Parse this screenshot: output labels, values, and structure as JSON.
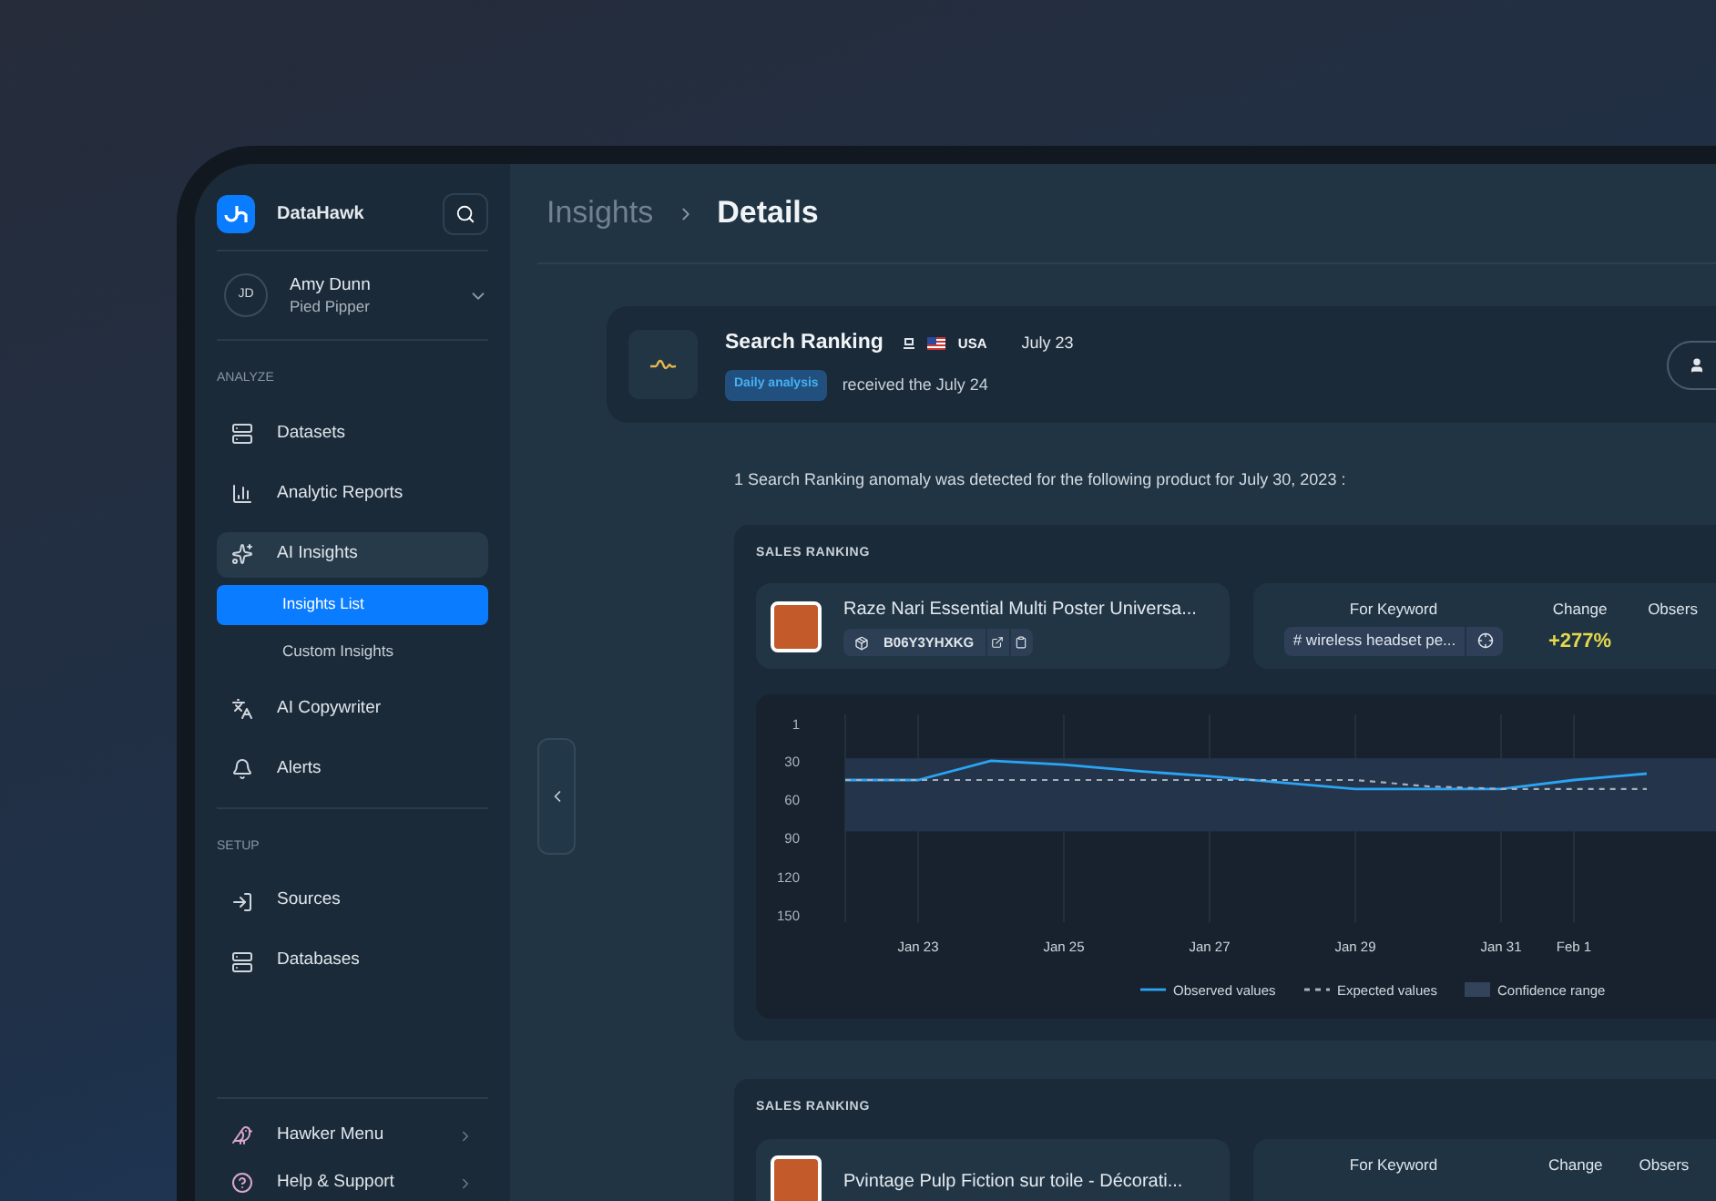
{
  "sidebar": {
    "brand": "DataHawk",
    "user": {
      "initials": "JD",
      "name": "Amy Dunn",
      "company": "Pied Pipper"
    },
    "sections": [
      {
        "title": "ANALYZE",
        "items": [
          {
            "label": "Datasets",
            "selected": false
          },
          {
            "label": "Analytic Reports",
            "selected": false
          },
          {
            "label": "AI Insights",
            "selected": true,
            "children": [
              {
                "label": "Insights List",
                "selected": true
              },
              {
                "label": "Custom Insights",
                "selected": false
              }
            ]
          },
          {
            "label": "AI Copywriter",
            "selected": false
          },
          {
            "label": "Alerts",
            "selected": false
          }
        ]
      },
      {
        "title": "SETUP",
        "items": [
          {
            "label": "Sources",
            "selected": false
          },
          {
            "label": "Databases",
            "selected": false
          }
        ]
      }
    ],
    "footer": [
      {
        "label": "Hawker Menu"
      },
      {
        "label": "Help & Support"
      }
    ]
  },
  "breadcrumb": [
    "Insights",
    "Details"
  ],
  "insight": {
    "title": "Search Ranking",
    "country": "USA",
    "date": "July 23",
    "badge": "Daily analysis",
    "received": "received the July 24"
  },
  "summary": "1 Search Ranking anomaly was detected for the following product for July 30, 2023 :",
  "sections": [
    {
      "title": "SALES RANKING",
      "product": "Raze Nari Essential Multi Poster Universa...",
      "asin": "B06Y3YHXKG",
      "keyword_label": "For Keyword",
      "keyword": "# wireless headset pe...",
      "change_label": "Change",
      "change": "+277%",
      "observed_label": "Obsers",
      "chart_data": {
        "type": "line",
        "categories": [
          null,
          "Jan 23",
          null,
          "Jan 25",
          null,
          "Jan 27",
          null,
          "Jan 29",
          null,
          "Jan 31",
          "Feb 1",
          null
        ],
        "ylim": [
          150,
          1
        ],
        "yticks": [
          1,
          30,
          60,
          90,
          120,
          150
        ],
        "grid": true,
        "legend": true,
        "series": [
          {
            "name": "Observed values",
            "color": "#2ba4f5",
            "line_style": "solid",
            "values": [
              45,
              45,
              30,
              33,
              38,
              42,
              47,
              52,
              52,
              52,
              45,
              40
            ]
          },
          {
            "name": "Expected values",
            "color": "#a7b0bb",
            "line_style": "dashed",
            "values": [
              45,
              45,
              45,
              45,
              45,
              45,
              45,
              45,
              50,
              52,
              52,
              52
            ]
          }
        ],
        "bands": [
          {
            "axis": "y",
            "label": "Confidence range",
            "from": 28,
            "to": 85
          }
        ]
      }
    },
    {
      "title": "SALES RANKING",
      "product": "Pvintage Pulp Fiction sur toile - Décorati...",
      "keyword_label": "For Keyword",
      "change_label": "Change",
      "observed_label": "Obsers"
    }
  ]
}
